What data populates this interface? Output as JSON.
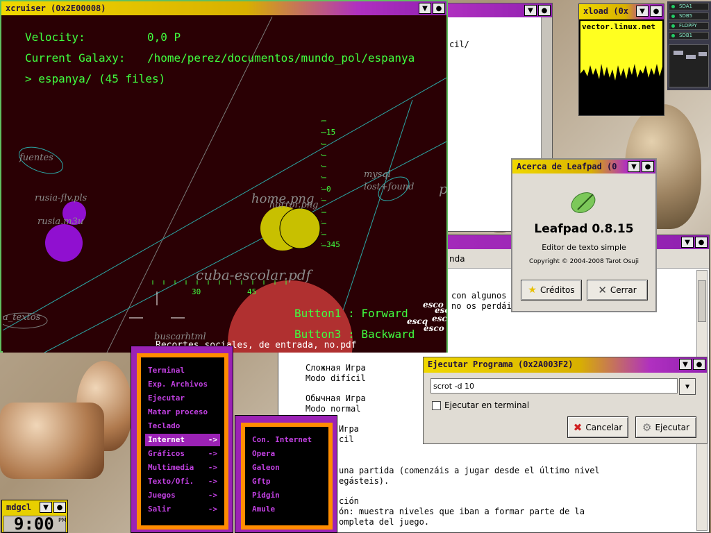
{
  "xcruiser": {
    "title": "xcruiser (0x2E00008)",
    "velocity_label": "Velocity:",
    "velocity_value": "0,0 P",
    "galaxy_label": "Current Galaxy:",
    "galaxy_path": "/home/perez/documentos/mundo_pol/espanya",
    "dir_line": "> espanya/ (45 files)",
    "button1": "Button1 : Forward",
    "button3": "Button3 : Backward",
    "scale_labels": [
      "15",
      "0",
      "345"
    ],
    "scale_bottom": [
      "30",
      "45"
    ],
    "items": {
      "fuentes": "fuentes",
      "rusia_flv": "rusia-flv.pls",
      "rusia_m3u": "rusia.m3u",
      "home": "home.png",
      "horror": "horror.png",
      "mysql": "mysql",
      "lost_found": "lost+found",
      "p": "p",
      "cuba": "cuba-escolar.pdf",
      "a_textos": "a_textos",
      "buscar": "buscarhtml",
      "recortes": "Recortes sociales, de entrada, no.pdf",
      "esco1": "esco",
      "esco2": "esc",
      "esco3": "escq",
      "esco4": "esco",
      "esco5": "esco"
    }
  },
  "bg_window": {
    "path_fragment": "cil/"
  },
  "xload": {
    "title": "xload (0x",
    "host": "vector.linux.net"
  },
  "dock": {
    "drives": [
      "SDA1",
      "SDB5",
      "FLOPPY",
      "SDB1"
    ]
  },
  "leafpad": {
    "title": "Acerca de Leafpad (0",
    "app_name": "Leafpad 0.8.15",
    "desc": "Editor de texto simple",
    "copyright": "Copyright © 2004-2008 Tarot Osuji",
    "credits_button": "Créditos",
    "close_button": "Cerrar"
  },
  "text_window": {
    "menu_fragment": "nda",
    "lines": [
      "con algunos",
      "no os perdái",
      "Сложная Игра",
      "Modo difícil",
      "Обычная Игра",
      "Modo normal",
      " Игра",
      "cil",
      "una partida (comenzáis a jugar desde el último nivel",
      "egásteis).",
      "ción",
      "ón: muestra niveles que iban a formar parte de la",
      "ompleta del juego."
    ]
  },
  "run_dialog": {
    "title": "Ejecutar Programa (0x2A003F2)",
    "command": "scrot -d 10",
    "terminal_checkbox": "Ejecutar en terminal",
    "cancel_button": "Cancelar",
    "run_button": "Ejecutar"
  },
  "main_menu": {
    "items": [
      {
        "label": "Terminal",
        "arrow": ""
      },
      {
        "label": "Exp. Archivos",
        "arrow": ""
      },
      {
        "label": "Ejecutar",
        "arrow": ""
      },
      {
        "label": "Matar proceso",
        "arrow": ""
      },
      {
        "label": "Teclado",
        "arrow": ""
      },
      {
        "label": "Internet",
        "arrow": "->"
      },
      {
        "label": "Gráficos",
        "arrow": "->"
      },
      {
        "label": "Multimedia",
        "arrow": "->"
      },
      {
        "label": "Texto/Ofi.",
        "arrow": "->"
      },
      {
        "label": "Juegos",
        "arrow": "->"
      },
      {
        "label": "Salir",
        "arrow": "->"
      }
    ]
  },
  "internet_menu": {
    "items": [
      "Con. Internet",
      "Opera",
      "Galeon",
      "Gftp",
      "Pidgin",
      "Amule"
    ]
  },
  "clock": {
    "title": "mdgcl",
    "time": "9:00",
    "ampm": "PM"
  }
}
